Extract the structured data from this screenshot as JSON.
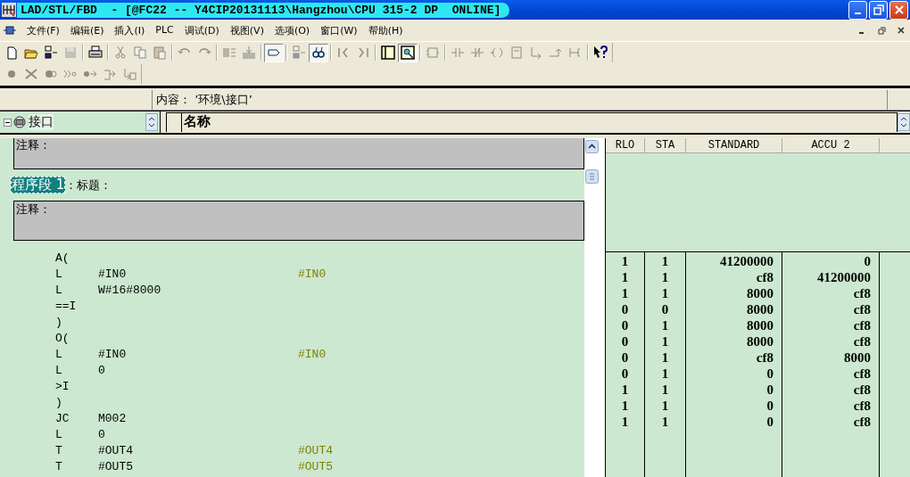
{
  "window": {
    "title": "LAD/STL/FBD  - [@FC22 -- Y4CIP20131113\\Hangzhou\\CPU 315-2 DP  ONLINE]"
  },
  "menu": [
    {
      "label": "文件(F)"
    },
    {
      "label": "编辑(E)"
    },
    {
      "label": "插入(I)"
    },
    {
      "label": "PLC"
    },
    {
      "label": "调试(D)"
    },
    {
      "label": "视图(V)"
    },
    {
      "label": "选项(O)"
    },
    {
      "label": "窗口(W)"
    },
    {
      "label": "帮助(H)"
    }
  ],
  "toolbar": [
    {
      "kind": "new",
      "disabled": false,
      "pressed": false
    },
    {
      "kind": "open",
      "disabled": false,
      "pressed": false
    },
    {
      "kind": "network",
      "disabled": false,
      "pressed": false
    },
    {
      "kind": "save",
      "disabled": true,
      "pressed": false
    },
    {
      "kind": "sep"
    },
    {
      "kind": "print",
      "disabled": false,
      "pressed": false
    },
    {
      "kind": "sep"
    },
    {
      "kind": "cut",
      "disabled": true,
      "pressed": false
    },
    {
      "kind": "copy",
      "disabled": true,
      "pressed": false
    },
    {
      "kind": "paste",
      "disabled": true,
      "pressed": false
    },
    {
      "kind": "sep"
    },
    {
      "kind": "undo",
      "disabled": true,
      "pressed": false
    },
    {
      "kind": "redo",
      "disabled": true,
      "pressed": false
    },
    {
      "kind": "sep"
    },
    {
      "kind": "compile",
      "disabled": true,
      "pressed": false
    },
    {
      "kind": "download",
      "disabled": true,
      "pressed": false
    },
    {
      "kind": "sep"
    },
    {
      "kind": "tag",
      "disabled": false,
      "pressed": true
    },
    {
      "kind": "sep"
    },
    {
      "kind": "network",
      "disabled": true,
      "pressed": false
    },
    {
      "kind": "glasses",
      "disabled": false,
      "pressed": true
    },
    {
      "kind": "sep"
    },
    {
      "kind": "prev",
      "disabled": true,
      "pressed": false
    },
    {
      "kind": "next",
      "disabled": true,
      "pressed": false
    },
    {
      "kind": "sep"
    },
    {
      "kind": "panel",
      "disabled": false,
      "pressed": false
    },
    {
      "kind": "details",
      "disabled": false,
      "pressed": true
    },
    {
      "kind": "sep"
    },
    {
      "kind": "block",
      "disabled": true,
      "pressed": false
    },
    {
      "kind": "sep"
    },
    {
      "kind": "contact",
      "disabled": true,
      "pressed": false
    },
    {
      "kind": "contact-nc",
      "disabled": true,
      "pressed": false
    },
    {
      "kind": "coil",
      "disabled": true,
      "pressed": false
    },
    {
      "kind": "box",
      "disabled": true,
      "pressed": false
    },
    {
      "kind": "branch",
      "disabled": true,
      "pressed": false
    },
    {
      "kind": "close-branch",
      "disabled": true,
      "pressed": false
    },
    {
      "kind": "connector",
      "disabled": true,
      "pressed": false
    },
    {
      "kind": "sep"
    },
    {
      "kind": "help",
      "disabled": false,
      "pressed": false
    }
  ],
  "toolbar_2": [
    {
      "kind": "dot",
      "disabled": true,
      "pressed": false
    },
    {
      "kind": "cross",
      "disabled": true,
      "pressed": false
    },
    {
      "kind": "dot-arrow",
      "disabled": true,
      "pressed": false
    },
    {
      "kind": "skip",
      "disabled": true,
      "pressed": false
    },
    {
      "kind": "step",
      "disabled": true,
      "pressed": false
    },
    {
      "kind": "jump",
      "disabled": true,
      "pressed": false
    },
    {
      "kind": "return",
      "disabled": true,
      "pressed": false
    }
  ],
  "content_bar": {
    "text": "内容： ’环境\\接口’"
  },
  "interface_tree": {
    "label": "接口",
    "expanded": true
  },
  "declaration_header": {
    "column": "名称"
  },
  "editor": {
    "prev_comment": "注释：",
    "network": {
      "label": "程序段 1",
      "title": "：标题：",
      "comment": "注释："
    },
    "lines": [
      {
        "op": "A("
      },
      {
        "op": "L",
        "operand": "#IN0",
        "comment": "#IN0"
      },
      {
        "op": "L",
        "operand": "W#16#8000"
      },
      {
        "op": "==I"
      },
      {
        "op": ")"
      },
      {
        "op": "O("
      },
      {
        "op": "L",
        "operand": "#IN0",
        "comment": "#IN0"
      },
      {
        "op": "L",
        "operand": "0"
      },
      {
        "op": ">I"
      },
      {
        "op": ")"
      },
      {
        "op": "JC",
        "operand": "M002"
      },
      {
        "op": "L",
        "operand": "0"
      },
      {
        "op": "T",
        "operand": "#OUT4",
        "comment": "#OUT4"
      },
      {
        "op": "T",
        "operand": "#OUT5",
        "comment": "#OUT5"
      }
    ]
  },
  "status_table": {
    "columns": [
      "RLO",
      "STA",
      "STANDARD",
      "ACCU 2"
    ],
    "rows": [
      [
        "1",
        "1",
        "41200000",
        "0"
      ],
      [
        "1",
        "1",
        "cf8",
        "41200000"
      ],
      [
        "1",
        "1",
        "8000",
        "cf8"
      ],
      [
        "0",
        "0",
        "8000",
        "cf8"
      ],
      [
        "0",
        "1",
        "8000",
        "cf8"
      ],
      [
        "0",
        "1",
        "8000",
        "cf8"
      ],
      [
        "0",
        "1",
        "cf8",
        "8000"
      ],
      [
        "0",
        "1",
        "0",
        "cf8"
      ],
      [
        "1",
        "1",
        "0",
        "cf8"
      ],
      [
        "1",
        "1",
        "0",
        "cf8"
      ],
      [
        "1",
        "1",
        "0",
        "cf8"
      ]
    ]
  }
}
